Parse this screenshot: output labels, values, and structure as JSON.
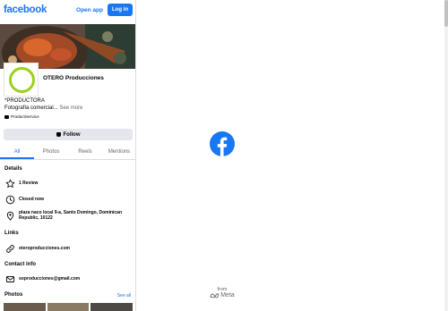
{
  "header": {
    "brand": "facebook",
    "open_app": "Open app",
    "login": "Log in"
  },
  "profile": {
    "name": "OTERO Producciones",
    "category_line": "*PRODUCTORA",
    "bio": "Fotografía comercial...",
    "see_more": "See more",
    "type": "Product/service",
    "follow": "Follow"
  },
  "tabs": [
    {
      "label": "All",
      "active": true
    },
    {
      "label": "Photos"
    },
    {
      "label": "Reels"
    },
    {
      "label": "Mentions"
    }
  ],
  "details": {
    "title": "Details",
    "reviews": "1 Review",
    "hours": "Closed now",
    "address": "plaza naco local 9-a, Santo Domingo, Dominican Republic, 10122"
  },
  "links": {
    "title": "Links",
    "website": "oteroproducciones.com"
  },
  "contact": {
    "title": "Contact info",
    "email": "soproducciones@gmail.com"
  },
  "photos": {
    "title": "Photos",
    "see_all": "See all"
  },
  "footer": {
    "from": "from",
    "meta": "Meta"
  },
  "colors": {
    "brand": "#1877f2",
    "avatar_ring": "#9dd11e"
  },
  "icons": [
    "star-icon",
    "clock-icon",
    "location-pin-icon",
    "link-icon",
    "mail-icon",
    "facebook-logo-icon",
    "meta-logo-icon",
    "briefcase-icon",
    "messenger-icon"
  ]
}
